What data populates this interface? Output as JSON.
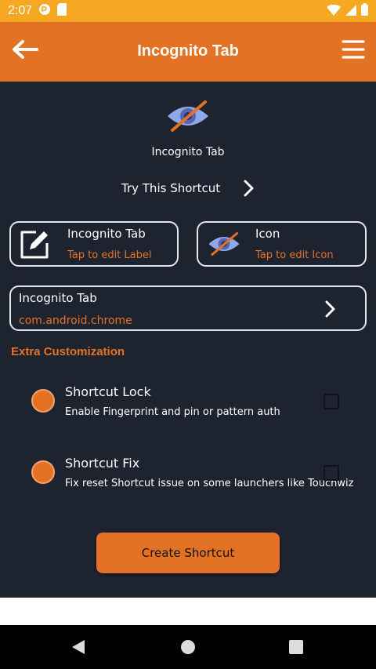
{
  "status_bar": {
    "time": "2:07",
    "icons": [
      "notification-icon",
      "sd-card-icon",
      "wifi-icon",
      "signal-icon",
      "battery-icon"
    ]
  },
  "toolbar": {
    "title": "Incognito Tab",
    "back_icon": "arrow-left-icon",
    "menu_icon": "hamburger-menu-icon"
  },
  "hero": {
    "icon": "incognito-eye-icon",
    "label": "Incognito Tab",
    "try_label": "Try This Shortcut"
  },
  "label_card": {
    "title": "Incognito Tab",
    "subtitle": "Tap to edit Label",
    "icon": "edit-pencil-icon"
  },
  "icon_card": {
    "title": "Icon",
    "subtitle": "Tap to edit Icon",
    "icon": "incognito-eye-icon"
  },
  "app_card": {
    "title": "Incognito Tab",
    "package": "com.android.chrome"
  },
  "extra": {
    "heading": "Extra Customization",
    "options": [
      {
        "title": "Shortcut Lock",
        "description": "Enable Fingerprint and pin or pattern auth",
        "checked": false
      },
      {
        "title": "Shortcut Fix",
        "description": "Fix reset Shortcut issue on some launchers like Touchwiz",
        "checked": false
      }
    ]
  },
  "create_button": {
    "label": "Create Shortcut"
  },
  "colors": {
    "accent": "#e47225",
    "status_bar": "#f7a823",
    "background": "#1e2330",
    "eye_blue": "#8fa8ea"
  }
}
